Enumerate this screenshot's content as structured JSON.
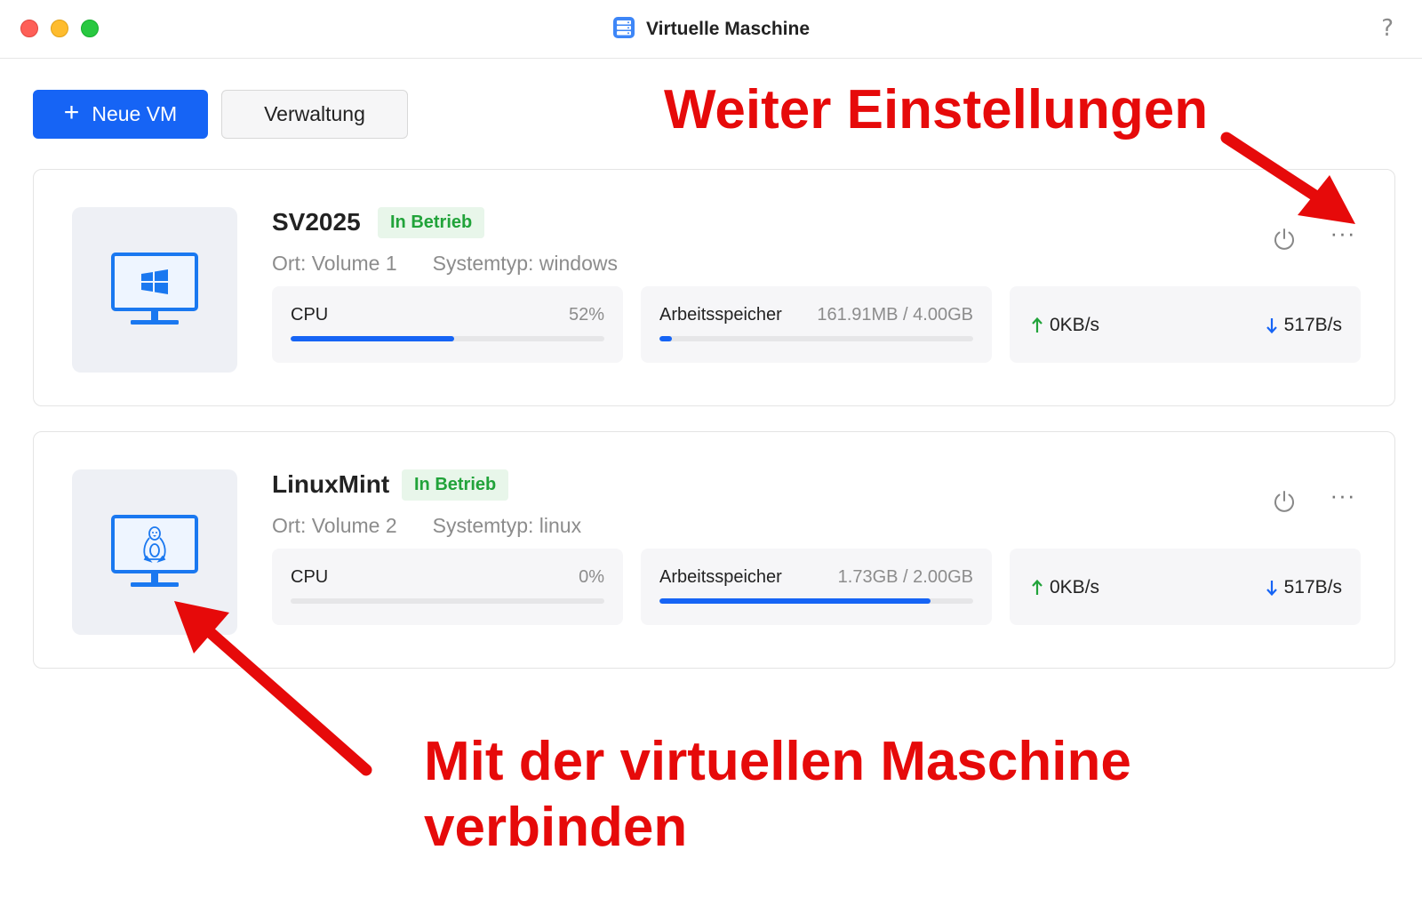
{
  "window": {
    "title": "Virtuelle Maschine",
    "help": "?"
  },
  "toolbar": {
    "new_vm_label": "Neue VM",
    "new_vm_icon": "plus-icon",
    "manage_label": "Verwaltung"
  },
  "vms": [
    {
      "name": "SV2025",
      "status": "In Betrieb",
      "location": "Ort: Volume 1",
      "system_type": "Systemtyp: windows",
      "os_icon": "windows-icon",
      "cpu_label": "CPU",
      "cpu_value": "52%",
      "cpu_fraction": 0.52,
      "memory_label": "Arbeitsspeicher",
      "memory_value": "161.91MB / 4.00GB",
      "memory_fraction": 0.04,
      "net_up": "0KB/s",
      "net_down": "517B/s"
    },
    {
      "name": "LinuxMint",
      "status": "In Betrieb",
      "location": "Ort: Volume 2",
      "system_type": "Systemtyp: linux",
      "os_icon": "linux-penguin-icon",
      "cpu_label": "CPU",
      "cpu_value": "0%",
      "cpu_fraction": 0.0,
      "memory_label": "Arbeitsspeicher",
      "memory_value": "1.73GB / 2.00GB",
      "memory_fraction": 0.865,
      "net_up": "0KB/s",
      "net_down": "517B/s"
    }
  ],
  "annotations": {
    "settings": "Weiter Einstellungen",
    "connect_line1": "Mit der virtuellen Maschine",
    "connect_line2": "verbinden"
  },
  "colors": {
    "accent": "#1664f5",
    "status_green": "#21a33a",
    "annotation_red": "#e60a0a",
    "upload_green": "#21a33a",
    "download_blue": "#1664f5"
  }
}
